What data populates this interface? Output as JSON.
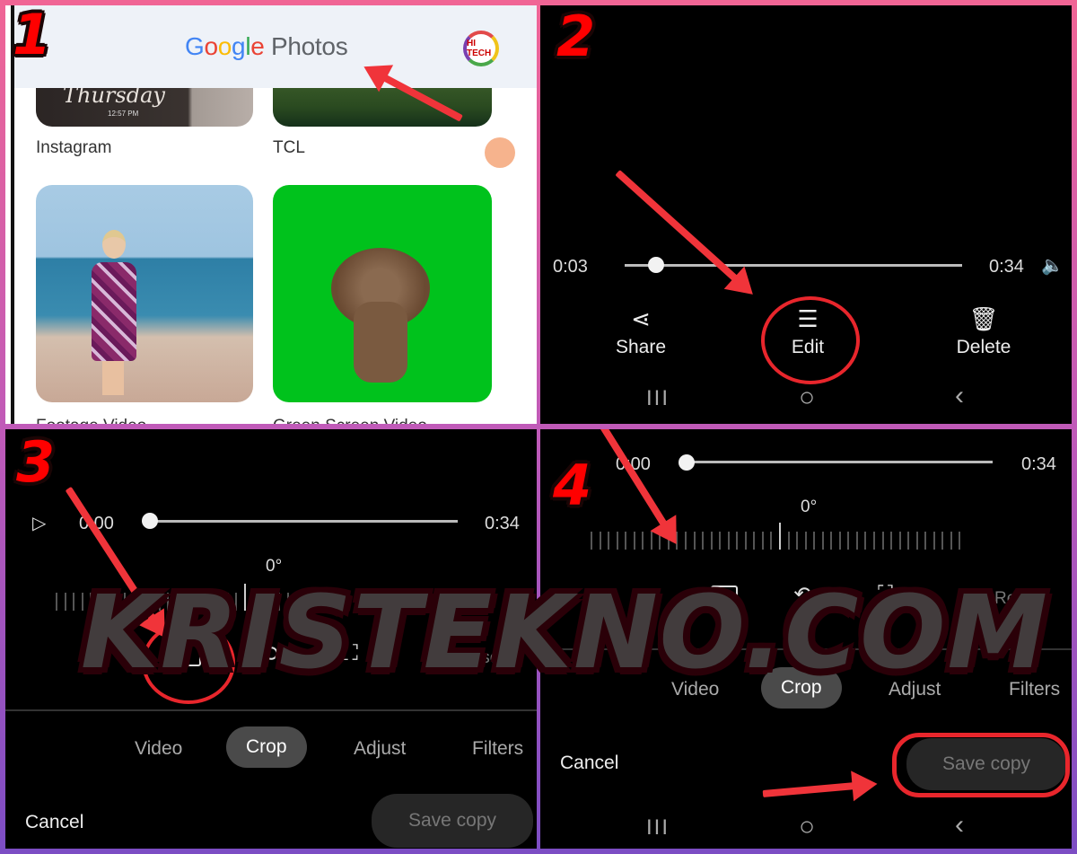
{
  "watermark": "KRISTEKNO.COM",
  "steps": [
    "1",
    "2",
    "3",
    "4"
  ],
  "panel1": {
    "app_title_google": [
      "G",
      "o",
      "o",
      "g",
      "l",
      "e"
    ],
    "app_title_photos": "Photos",
    "avatar_label": "HI TECH",
    "albums": [
      {
        "label": "Instagram",
        "thumb_text": "Thursday",
        "thumb_time": "12:57 PM"
      },
      {
        "label": "TCL"
      },
      {
        "label": "Footage Video"
      },
      {
        "label": "Green Screen Video"
      }
    ],
    "colors": {
      "blue": "#4285f4",
      "red": "#ea4335",
      "yellow": "#fbbc05",
      "green": "#34a853"
    }
  },
  "panel2": {
    "current_time": "0:03",
    "duration": "0:34",
    "progress_fraction": 0.09,
    "volume_icon": "speaker-icon",
    "actions": [
      {
        "label": "Share",
        "icon": "share-icon"
      },
      {
        "label": "Edit",
        "icon": "sliders-icon"
      },
      {
        "label": "Delete",
        "icon": "trash-icon"
      }
    ]
  },
  "panel3": {
    "current_time": "0:00",
    "duration": "0:34",
    "progress_fraction": 0.0,
    "rotation": "0°",
    "reset_label": "Reset",
    "tabs": [
      "Video",
      "Crop",
      "Adjust",
      "Filters"
    ],
    "active_tab": "Crop",
    "cancel_label": "Cancel",
    "save_label": "Save copy"
  },
  "panel4": {
    "current_time": "0:00",
    "duration": "0:34",
    "progress_fraction": 0.0,
    "rotation": "0°",
    "reset_label": "Reset",
    "tabs": [
      "Video",
      "Crop",
      "Adjust",
      "Filters"
    ],
    "active_tab": "Crop",
    "cancel_label": "Cancel",
    "save_label": "Save copy"
  },
  "navbar": {
    "recents": "III",
    "home": "○",
    "back": "‹"
  },
  "accent_color": "#e8262c"
}
